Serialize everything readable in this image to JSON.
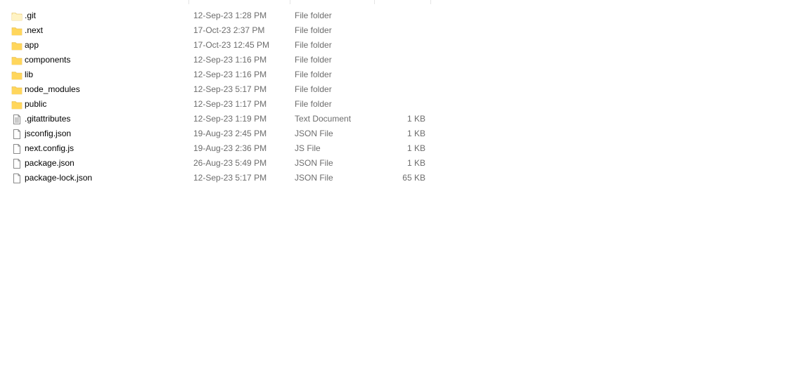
{
  "files": [
    {
      "name": ".git",
      "modified": "12-Sep-23 1:28 PM",
      "type": "File folder",
      "size": "",
      "icon": "folder-hidden-icon"
    },
    {
      "name": ".next",
      "modified": "17-Oct-23 2:37 PM",
      "type": "File folder",
      "size": "",
      "icon": "folder-icon"
    },
    {
      "name": "app",
      "modified": "17-Oct-23 12:45 PM",
      "type": "File folder",
      "size": "",
      "icon": "folder-icon"
    },
    {
      "name": "components",
      "modified": "12-Sep-23 1:16 PM",
      "type": "File folder",
      "size": "",
      "icon": "folder-icon"
    },
    {
      "name": "lib",
      "modified": "12-Sep-23 1:16 PM",
      "type": "File folder",
      "size": "",
      "icon": "folder-icon"
    },
    {
      "name": "node_modules",
      "modified": "12-Sep-23 5:17 PM",
      "type": "File folder",
      "size": "",
      "icon": "folder-icon"
    },
    {
      "name": "public",
      "modified": "12-Sep-23 1:17 PM",
      "type": "File folder",
      "size": "",
      "icon": "folder-icon"
    },
    {
      "name": ".gitattributes",
      "modified": "12-Sep-23 1:19 PM",
      "type": "Text Document",
      "size": "1 KB",
      "icon": "text-document-icon"
    },
    {
      "name": "jsconfig.json",
      "modified": "19-Aug-23 2:45 PM",
      "type": "JSON File",
      "size": "1 KB",
      "icon": "file-icon"
    },
    {
      "name": "next.config.js",
      "modified": "19-Aug-23 2:36 PM",
      "type": "JS File",
      "size": "1 KB",
      "icon": "file-icon"
    },
    {
      "name": "package.json",
      "modified": "26-Aug-23 5:49 PM",
      "type": "JSON File",
      "size": "1 KB",
      "icon": "file-icon"
    },
    {
      "name": "package-lock.json",
      "modified": "12-Sep-23 5:17 PM",
      "type": "JSON File",
      "size": "65 KB",
      "icon": "file-icon"
    }
  ],
  "colors": {
    "folder": "#ffd65c",
    "folder_hidden": "#fff3c4",
    "file_outline": "#8a8a8a",
    "secondary_text": "#6d6d6d",
    "hover": "#e5f3ff"
  }
}
